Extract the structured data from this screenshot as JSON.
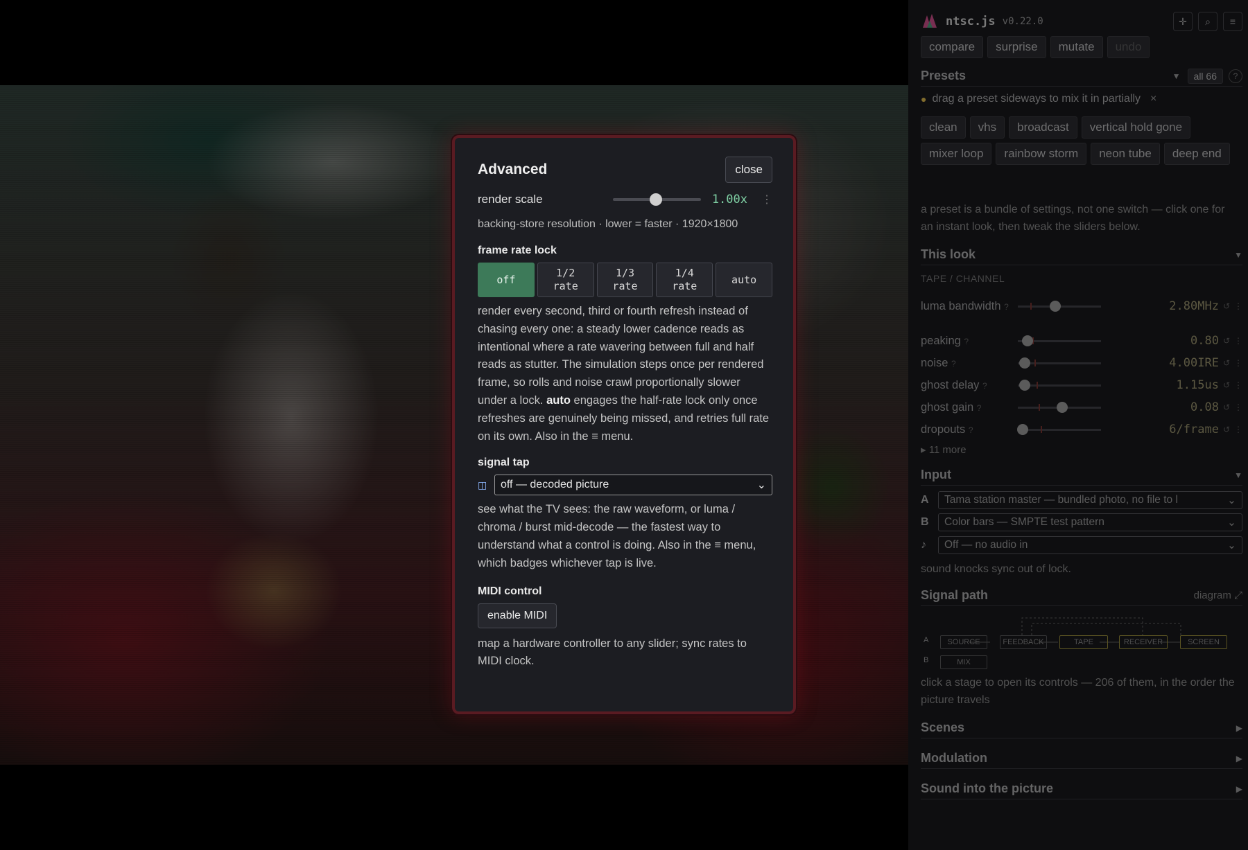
{
  "modal": {
    "title": "Advanced",
    "close_label": "close",
    "render_scale": {
      "label": "render scale",
      "value": "1.00x",
      "level": 0.48
    },
    "backing_note": "backing-store resolution · lower = faster · 1920×1800",
    "frame_rate": {
      "heading": "frame rate lock",
      "options": [
        {
          "line1": "off",
          "line2": ""
        },
        {
          "line1": "1/2",
          "line2": "rate"
        },
        {
          "line1": "1/3",
          "line2": "rate"
        },
        {
          "line1": "1/4",
          "line2": "rate"
        },
        {
          "line1": "auto",
          "line2": ""
        }
      ],
      "selected": "off",
      "desc_a": "render every second, third or fourth refresh instead of chasing every one: a steady lower cadence reads as intentional where a rate wavering between full and half reads as stutter. The simulation steps once per rendered frame, so rolls and noise crawl proportionally slower under a lock.",
      "desc_bold": "auto",
      "desc_b": "engages the half-rate lock only once refreshes are genuinely being missed, and retries full rate on its own. Also in the ≡ menu."
    },
    "signal_tap": {
      "heading": "signal tap",
      "selected": "off — decoded picture",
      "desc": "see what the TV sees: the raw waveform, or luma / chroma / burst mid-decode — the fastest way to understand what a control is doing. Also in the ≡ menu, which badges whichever tap is live."
    },
    "midi": {
      "heading": "MIDI control",
      "button": "enable MIDI",
      "desc": "map a hardware controller to any slider; sync rates to MIDI clock."
    }
  },
  "panel": {
    "app_name": "ntsc.js",
    "version": "v0.22.0",
    "actions": [
      "compare",
      "surprise",
      "mutate",
      "undo"
    ],
    "presets": {
      "title": "Presets",
      "filter": "all 66",
      "help": "?",
      "tip": "drag a preset sideways to mix it in partially",
      "tip_close": "×",
      "items": [
        "clean",
        "vhs",
        "broadcast",
        "vertical hold gone",
        "mixer loop",
        "rainbow storm",
        "neon tube",
        "deep end"
      ],
      "note": "a preset is a bundle of settings, not one switch — click one for an instant look, then tweak the sliders below."
    },
    "this_look": {
      "title": "This look",
      "group": "TAPE / CHANNEL",
      "controls": [
        {
          "name": "luma bandwidth",
          "value": "2.80MHz",
          "level": 0.45
        },
        {
          "name": "peaking",
          "value": "0.80",
          "level": 0.12
        },
        {
          "name": "noise",
          "value": "4.00IRE",
          "level": 0.08
        },
        {
          "name": "ghost delay",
          "value": "1.15us",
          "level": 0.08
        },
        {
          "name": "ghost gain",
          "value": "0.08",
          "level": 0.53
        },
        {
          "name": "dropouts",
          "value": "6/frame",
          "level": 0.06
        }
      ],
      "more": "▸ 11 more"
    },
    "input": {
      "title": "Input",
      "rows": [
        {
          "key": "A",
          "value": "Tama station master — bundled photo, no file to l"
        },
        {
          "key": "B",
          "value": "Color bars — SMPTE test pattern"
        },
        {
          "key": "♪",
          "value": "Off — no audio in"
        }
      ],
      "note": "sound knocks sync out of lock."
    },
    "signal_path": {
      "title": "Signal path",
      "diagram_link": "diagram ⤢",
      "nodes": [
        "SOURCE",
        "FEEDBACK",
        "TAPE",
        "RECEIVER",
        "SCREEN",
        "MIX"
      ],
      "row_a": "A",
      "row_b": "B",
      "note": "click a stage to open its controls — 206 of them, in the order the picture travels"
    },
    "collapsed": [
      "Scenes",
      "Modulation",
      "Sound into the picture"
    ]
  }
}
